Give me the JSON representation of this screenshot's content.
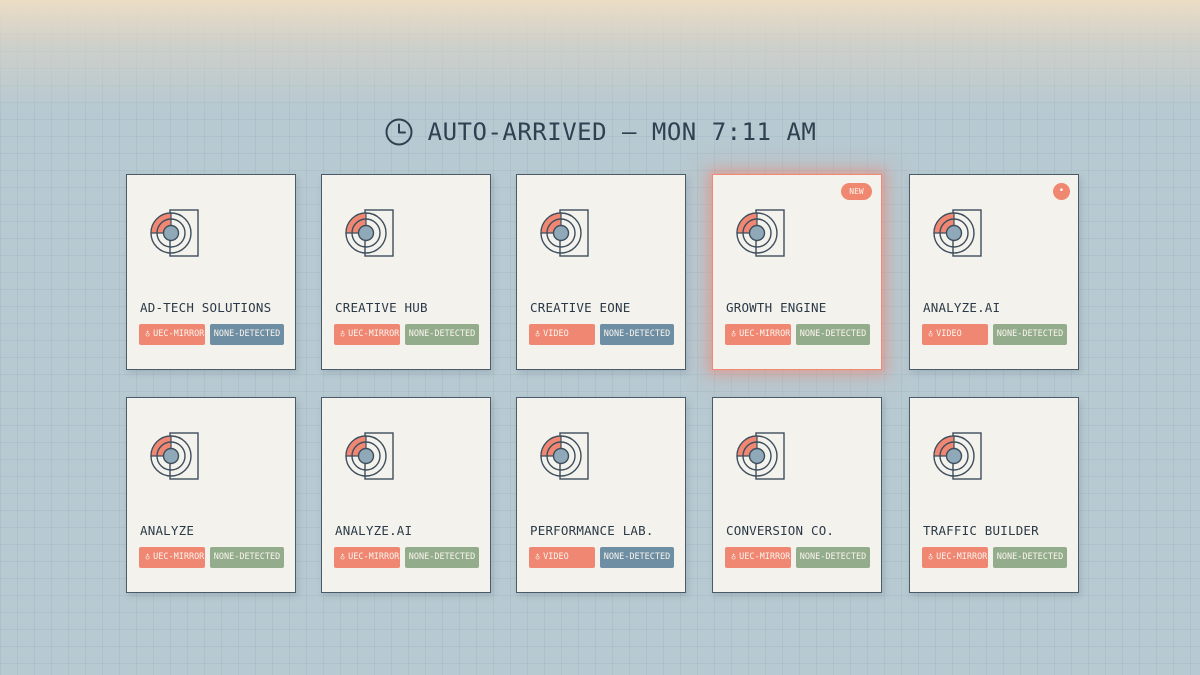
{
  "header": {
    "title": "AUTO-ARRIVED — MON 7:11 AM",
    "icon": "clock-icon"
  },
  "colors": {
    "coral": "#ef8772",
    "blue": "#6d8ea3",
    "green": "#93ad8c",
    "card": "#f4f2ec",
    "ink": "#2f4150"
  },
  "cards": [
    {
      "name": "AD-TECH SOLUTIONS",
      "format_tag": "UEC-MIRROR",
      "detect_tag": "NONE-DETECTED",
      "detect_color": "blue",
      "badge": "",
      "highlighted": false
    },
    {
      "name": "CREATIVE HUB",
      "format_tag": "UEC-MIRROR",
      "detect_tag": "NONE-DETECTED",
      "detect_color": "green",
      "badge": "",
      "highlighted": false
    },
    {
      "name": "CREATIVE EONE",
      "format_tag": "VIDEO",
      "detect_tag": "NONE-DETECTED",
      "detect_color": "blue",
      "badge": "",
      "highlighted": false
    },
    {
      "name": "GROWTH ENGINE",
      "format_tag": "UEC-MIRROR",
      "detect_tag": "NONE-DETECTED",
      "detect_color": "green",
      "badge": "NEW",
      "highlighted": true
    },
    {
      "name": "ANALYZE.AI",
      "format_tag": "VIDEO",
      "detect_tag": "NONE-DETECTED",
      "detect_color": "green",
      "badge": "•",
      "highlighted": false
    },
    {
      "name": "ANALYZE",
      "format_tag": "UEC-MIRROR",
      "detect_tag": "NONE-DETECTED",
      "detect_color": "green",
      "badge": "",
      "highlighted": false
    },
    {
      "name": "ANALYZE.AI",
      "format_tag": "UEC-MIRROR",
      "detect_tag": "NONE-DETECTED",
      "detect_color": "green",
      "badge": "",
      "highlighted": false
    },
    {
      "name": "PERFORMANCE LAB.",
      "format_tag": "VIDEO",
      "detect_tag": "NONE-DETECTED",
      "detect_color": "blue",
      "badge": "",
      "highlighted": false
    },
    {
      "name": "CONVERSION CO.",
      "format_tag": "UEC-MIRROR",
      "detect_tag": "NONE-DETECTED",
      "detect_color": "green",
      "badge": "",
      "highlighted": false
    },
    {
      "name": "TRAFFIC BUILDER",
      "format_tag": "UEC-MIRROR",
      "detect_tag": "NONE-DETECTED",
      "detect_color": "green",
      "badge": "",
      "highlighted": false
    }
  ]
}
